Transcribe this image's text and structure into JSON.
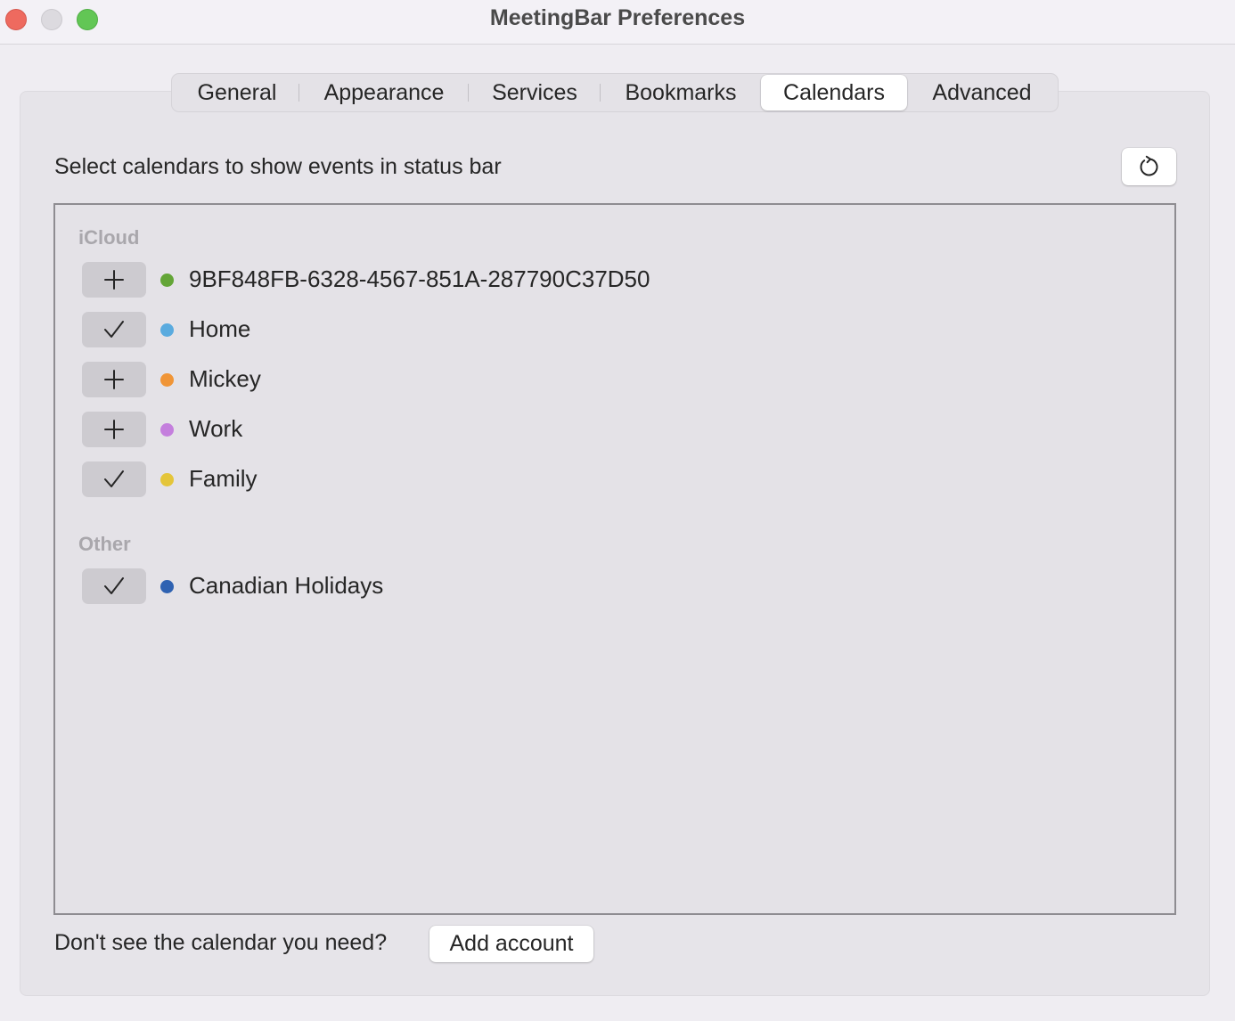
{
  "window": {
    "title": "MeetingBar Preferences"
  },
  "tabs": [
    {
      "label": "General",
      "active": false
    },
    {
      "label": "Appearance",
      "active": false
    },
    {
      "label": "Services",
      "active": false
    },
    {
      "label": "Bookmarks",
      "active": false
    },
    {
      "label": "Calendars",
      "active": true
    },
    {
      "label": "Advanced",
      "active": false
    }
  ],
  "calendars_page": {
    "prompt": "Select calendars to show events in status bar",
    "refresh_icon": "refresh-icon",
    "sections": [
      {
        "header": "iCloud",
        "calendars": [
          {
            "name": "9BF848FB-6328-4567-851A-287790C37D50",
            "color": "#63a537",
            "selected": false
          },
          {
            "name": "Home",
            "color": "#5aabdf",
            "selected": true
          },
          {
            "name": "Mickey",
            "color": "#f09537",
            "selected": false
          },
          {
            "name": "Work",
            "color": "#c47fdd",
            "selected": false
          },
          {
            "name": "Family",
            "color": "#e4c53a",
            "selected": true
          }
        ]
      },
      {
        "header": "Other",
        "calendars": [
          {
            "name": "Canadian Holidays",
            "color": "#2f62b2",
            "selected": true
          }
        ]
      }
    ],
    "footer_text": "Don't see the calendar you need?",
    "add_account_label": "Add account"
  }
}
